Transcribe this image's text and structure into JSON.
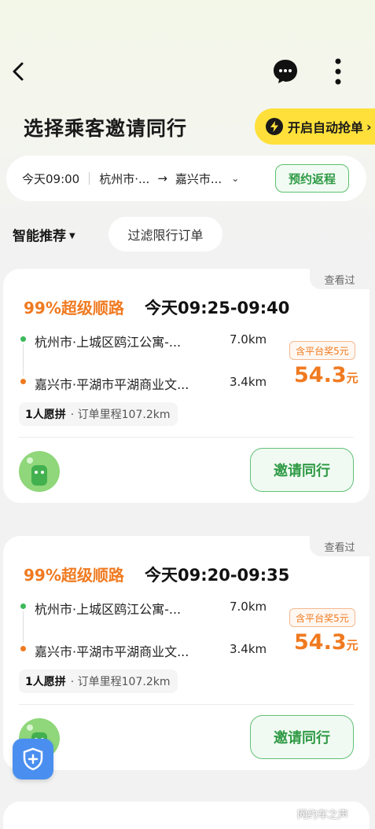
{
  "header": {
    "title": "选择乘客邀请同行",
    "auto_grab_label": "开启自动抢单"
  },
  "route_bar": {
    "time": "今天09:00",
    "from": "杭州市·...",
    "to": "嘉兴市...",
    "return_button": "预约返程"
  },
  "filters": {
    "sort_label": "智能推荐",
    "filter_label": "过滤限行订单"
  },
  "cards": [
    {
      "seen": "查看过",
      "match": "99%超级顺路",
      "time": "今天09:25-09:40",
      "from": "杭州市·上城区鸥江公寓-...",
      "from_km": "7.0km",
      "to": "嘉兴市·平湖市平湖商业文...",
      "to_km": "3.4km",
      "bonus": "含平台奖5元",
      "price": "54.3",
      "price_unit": "元",
      "riders": "1人愿拼",
      "distance": "· 订单里程107.2km",
      "invite": "邀请同行"
    },
    {
      "seen": "查看过",
      "match": "99%超级顺路",
      "time": "今天09:20-09:35",
      "from": "杭州市·上城区鸥江公寓-...",
      "from_km": "7.0km",
      "to": "嘉兴市·平湖市平湖商业文...",
      "to_km": "3.4km",
      "bonus": "含平台奖5元",
      "price": "54.3",
      "price_unit": "元",
      "riders": "1人愿拼",
      "distance": "· 订单里程107.2km",
      "invite": "邀请同行"
    }
  ],
  "watermark": "网约车之声",
  "colors": {
    "accent_orange": "#f07a20",
    "accent_green": "#2f9a45",
    "grab_yellow": "#ffe03a",
    "shield_blue": "#4a8ff0"
  },
  "icons": [
    "back-icon",
    "message-icon",
    "more-icon",
    "bolt-icon",
    "shield-icon"
  ]
}
